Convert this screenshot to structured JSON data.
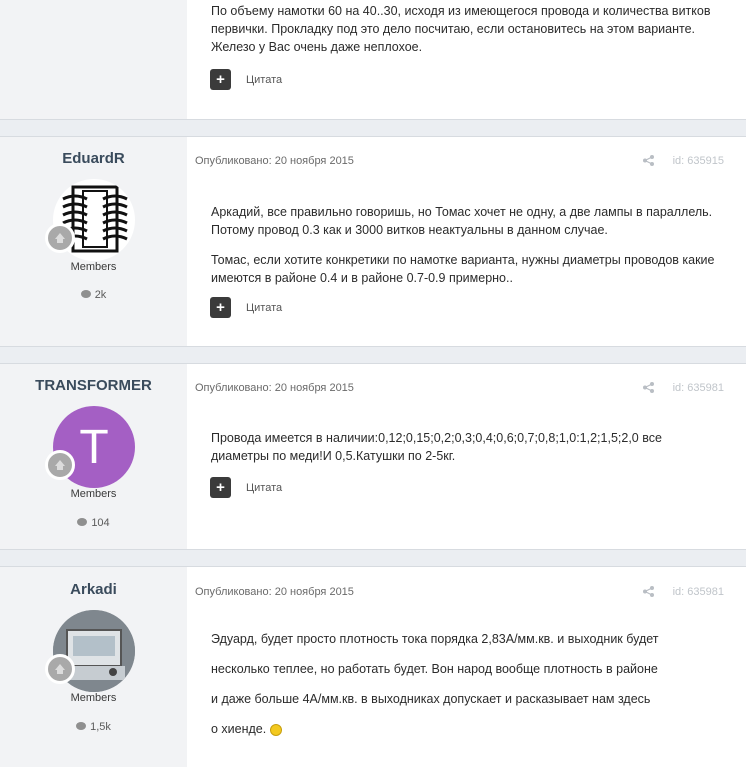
{
  "posts": [
    {
      "content": [
        "По объему намотки 60 на 40..30, исходя из имеющегося провода и количества витков первички. Прокладку под это дело посчитаю, если остановитесь на этом варианте. Железо у Вас очень даже неплохое."
      ],
      "quote_label": "Цитата"
    },
    {
      "author": "EduardR",
      "group": "Members",
      "post_count": "2k",
      "date": "Опубликовано: 20 ноября 2015",
      "post_id": "id: 635915",
      "content": [
        "Аркадий, все правильно говоришь, но Томас хочет не одну, а две лампы в параллель. Потому провод 0.3 как и 3000 витков неактуальны в данном случае.",
        "Томас, если хотите конкретики по намотке варианта, нужны диаметры проводов какие имеются в районе 0.4 и в районе 0.7-0.9 примерно.."
      ],
      "quote_label": "Цитата"
    },
    {
      "author": "TRANSFORMER",
      "avatar_letter": "T",
      "group": "Members",
      "post_count": "104",
      "date": "Опубликовано: 20 ноября 2015",
      "post_id": "id: 635981",
      "content": [
        "Провода имеется в наличии:0,12;0,15;0,2;0,3;0,4;0,6;0,7;0,8;1,0:1,2;1,5;2,0 все диаметры по меди!И 0,5.Катушки по 2-5кг."
      ],
      "quote_label": "Цитата"
    },
    {
      "author": "Arkadi",
      "group": "Members",
      "post_count": "1,5k",
      "date": "Опубликовано: 20 ноября 2015",
      "post_id": "id: 635981",
      "content": [
        "Эдуард, будет просто плотность тока порядка 2,83А/мм.кв. и выходник будет",
        "несколько теплее, но работать будет. Вон народ вообще плотность в районе",
        "и даже больше 4А/мм.кв. в выходниках допускает и расказывает нам здесь",
        "о хиенде."
      ]
    }
  ],
  "colors": {
    "page_bg": "#ebeef2",
    "author_bg": "#f2f3f5",
    "avatar_purple": "#a45fc4",
    "name": "#3a4b5c"
  }
}
